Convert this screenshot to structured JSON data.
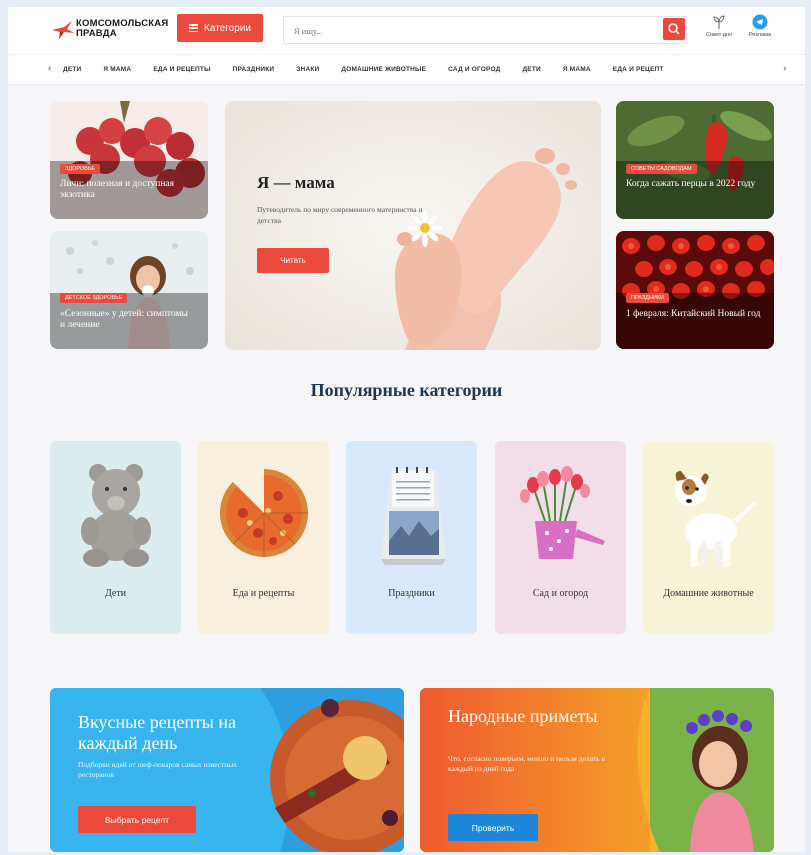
{
  "header": {
    "logo_line1": "КОМСОМОЛЬСКАЯ",
    "logo_line2": "ПРАВДА",
    "categories_button": "Категории",
    "search_placeholder": "Я ищу...",
    "garden_tip_label": "Совет дня",
    "ads_label": "Реклама"
  },
  "nav": {
    "items": [
      "ДЕТИ",
      "Я МАМА",
      "ЕДА И РЕЦЕПТЫ",
      "ПРАЗДНИКИ",
      "ЗНАКИ",
      "ДОМАШНИЕ ЖИВОТНЫЕ",
      "САД И ОГОРОД",
      "ДЕТИ",
      "Я МАМА",
      "ЕДА И РЕЦЕПТ"
    ],
    "prev_arrow": "‹",
    "next_arrow": "›"
  },
  "hero": {
    "left_top": {
      "tag": "ЗДОРОВЬЕ",
      "title": "Личи: полезная и доступная экзотика"
    },
    "left_bottom": {
      "tag": "ДЕТСКОЕ ЗДОРОВЬЕ",
      "title": "«Сезонные» у детей: симптомы и лечение"
    },
    "center": {
      "title": "Я — мама",
      "subtitle": "Путеводитель по миру современного материнства и детства",
      "button": "Читать"
    },
    "right_top": {
      "tag": "СОВЕТЫ САДОВОДАМ",
      "title": "Когда сажать перцы в 2022 году"
    },
    "right_bottom": {
      "tag": "ПРАЗДНИКИ",
      "title": "1 февраля: Китайский Новый год"
    }
  },
  "popular": {
    "title": "Популярные категории",
    "categories": [
      {
        "label": "Дети",
        "bg": "#dcecef"
      },
      {
        "label": "Еда и рецепты",
        "bg": "#f8efdc"
      },
      {
        "label": "Праздники",
        "bg": "#d9e8fb"
      },
      {
        "label": "Сад и огород",
        "bg": "#f2dee9"
      },
      {
        "label": "Домашние животные",
        "bg": "#f6f3d7"
      }
    ]
  },
  "promos": {
    "recipes": {
      "title": "Вкусные рецепты на каждый день",
      "subtitle": "Подборки идей от шеф-поваров самых известных ресторанов",
      "button": "Выбрать рецепт"
    },
    "signs": {
      "title": "Народные приметы",
      "subtitle": "Что, согласно поверьям, можно и нельзя делать в каждый из дней года",
      "button": "Проверить"
    }
  },
  "colors": {
    "accent": "#e94a3c",
    "heading": "#1f3550",
    "blue_button": "#1e86d6"
  }
}
